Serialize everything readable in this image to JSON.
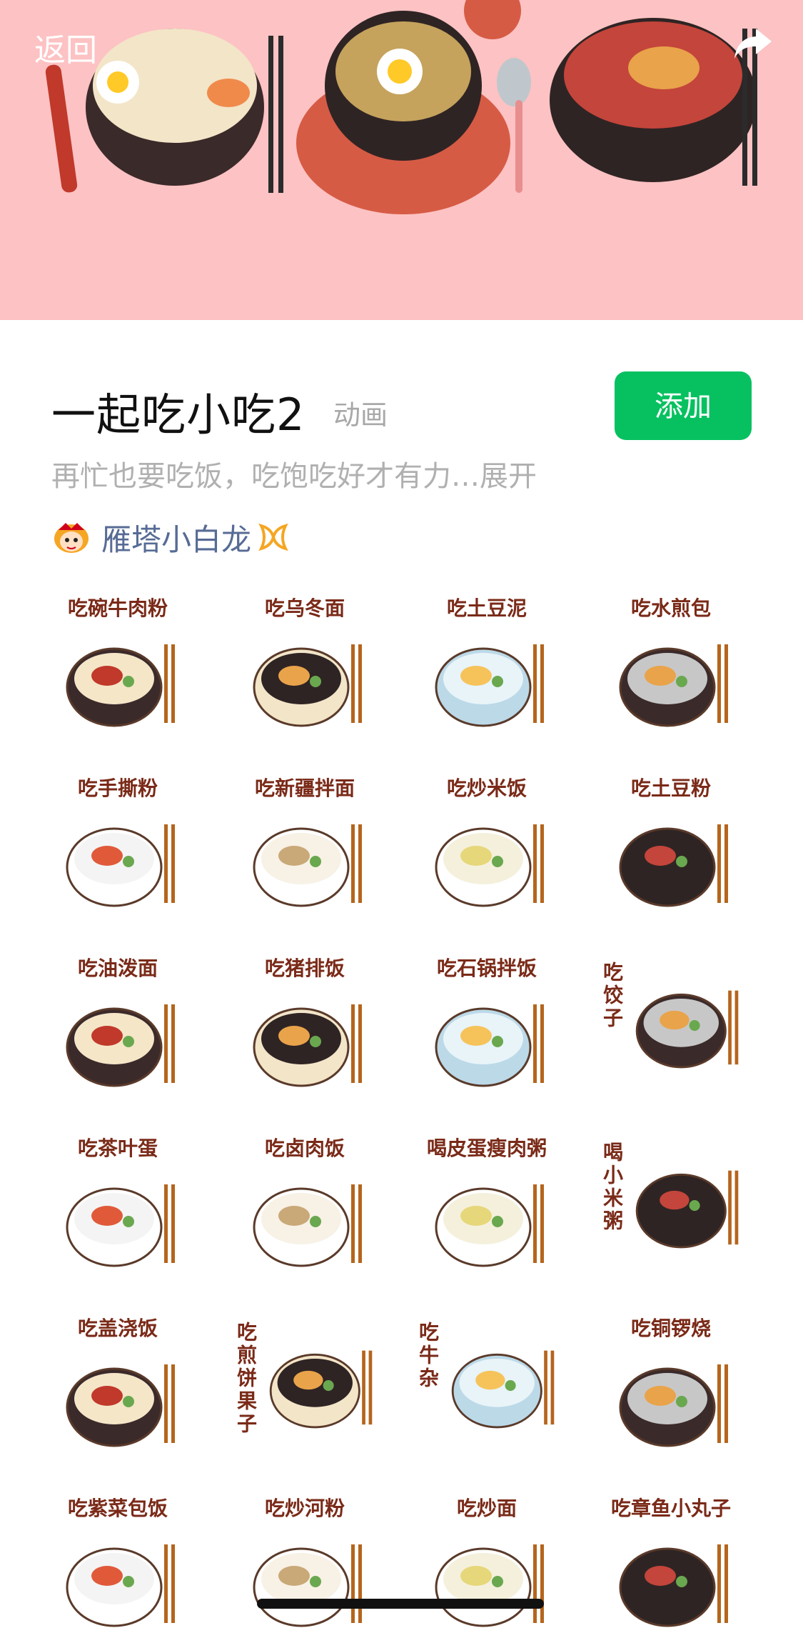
{
  "nav": {
    "back_label": "返回",
    "share_icon": "share-arrow-icon"
  },
  "sticker_pack": {
    "title": "一起吃小吃2",
    "type_tag": "动画",
    "add_label": "添加",
    "description": "再忙也要吃饭，吃饱吃好才有力…展开",
    "author": "雁塔小白龙"
  },
  "colors": {
    "banner_bg": "#fdc2c3",
    "add_button": "#07c160",
    "author_link": "#576b95",
    "sticker_text": "#7a2a18"
  },
  "stickers": [
    {
      "label": "吃碗牛肉粉",
      "vertical": false
    },
    {
      "label": "吃乌冬面",
      "vertical": false
    },
    {
      "label": "吃土豆泥",
      "vertical": false
    },
    {
      "label": "吃水煎包",
      "vertical": false
    },
    {
      "label": "吃手撕粉",
      "vertical": false
    },
    {
      "label": "吃新疆拌面",
      "vertical": false
    },
    {
      "label": "吃炒米饭",
      "vertical": false
    },
    {
      "label": "吃土豆粉",
      "vertical": false
    },
    {
      "label": "吃油泼面",
      "vertical": false
    },
    {
      "label": "吃猪排饭",
      "vertical": false
    },
    {
      "label": "吃石锅拌饭",
      "vertical": false
    },
    {
      "label": "吃饺子",
      "vertical": true
    },
    {
      "label": "吃茶叶蛋",
      "vertical": false
    },
    {
      "label": "吃卤肉饭",
      "vertical": false
    },
    {
      "label": "喝皮蛋瘦肉粥",
      "vertical": false
    },
    {
      "label": "喝小米粥",
      "vertical": true
    },
    {
      "label": "吃盖浇饭",
      "vertical": false
    },
    {
      "label": "吃煎饼果子",
      "vertical": true
    },
    {
      "label": "吃牛杂",
      "vertical": true
    },
    {
      "label": "吃铜锣烧",
      "vertical": false
    },
    {
      "label": "吃紫菜包饭",
      "vertical": false
    },
    {
      "label": "吃炒河粉",
      "vertical": false
    },
    {
      "label": "吃炒面",
      "vertical": false
    },
    {
      "label": "吃章鱼小丸子",
      "vertical": false
    }
  ]
}
